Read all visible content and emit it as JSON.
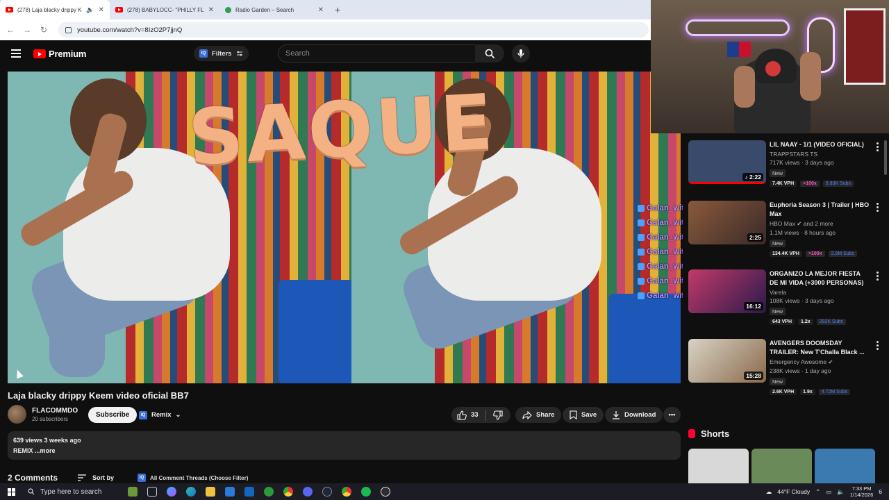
{
  "browser": {
    "tabs": [
      {
        "label": "(278) Laja blacky drippy Ke",
        "icon": "youtube-icon",
        "active": true,
        "audio": "🔈"
      },
      {
        "label": "(278) BABYLOCC- \"PHILLY FLOW",
        "icon": "youtube-icon",
        "active": false
      },
      {
        "label": "Radio Garden – Search",
        "icon": "radio-garden-icon",
        "active": false
      }
    ],
    "close_glyph": "✕",
    "new_tab_glyph": "+",
    "url": "youtube.com/watch?v=8IzO2P7jjnQ"
  },
  "youtube_header": {
    "logo_text": "Premium",
    "filters_label": "Filters",
    "filters_badge": "IQ",
    "search_placeholder": "Search"
  },
  "video": {
    "overlay_text": "SAQUE",
    "title": "Laja blacky drippy Keem video oficial BB7",
    "channel": "FLACOMMDO",
    "subscribers": "20 subscribers",
    "subscribe_label": "Subscribe",
    "remix_label": "Remix",
    "likes": "33",
    "share_label": "Share",
    "save_label": "Save",
    "download_label": "Download",
    "views_date": "639 views  3 weeks ago",
    "description": "REMIX ...more"
  },
  "chat_overlay": {
    "lines": [
      "Galan_witheclips :",
      "Galan_witheclips :",
      "Galan_witheclips :",
      "Galan_witheclips :",
      "Galan_witheclips :",
      "Galan_witheclips :",
      "Galan_witheclips :"
    ]
  },
  "recommendations": [
    {
      "title": "LIL NAAY - 1/1 (VIDEO OFICIAL)",
      "channel": "TRAPPSTARS TS",
      "meta": "717K views · 3 days ago",
      "badge": "New",
      "duration": "♪ 2:22",
      "vph": "7.4K VPH",
      "ratio": ">100x",
      "subs": "9.83K Subs",
      "thumb_color": "#3a4a6a"
    },
    {
      "title": "Euphoria Season 3 | Trailer | HBO Max",
      "channel": "HBO Max ✔ and 2 more",
      "meta": "1.1M views · 8 hours ago",
      "badge": "New",
      "duration": "2:25",
      "vph": "134.4K VPH",
      "ratio": ">100x",
      "subs": "2.9M Subs",
      "thumb_color": "#6b4a3a"
    },
    {
      "title": "ORGANIZO LA MEJOR FIESTA DE MI VIDA (+3000 PERSONAS)",
      "channel": "Varela",
      "meta": "108K views · 3 days ago",
      "badge": "New",
      "duration": "16:12",
      "vph": "643 VPH",
      "ratio": "1.2x",
      "subs": "292K Subs",
      "thumb_color": "#4a2a6a"
    },
    {
      "title": "AVENGERS DOOMSDAY TRAILER: New T'Challa Black ...",
      "channel": "Emergency Awesome ✔",
      "meta": "238K views · 1 day ago",
      "badge": "New",
      "duration": "15:28",
      "vph": "2.6K VPH",
      "ratio": "1.9x",
      "subs": "4.72M Subs",
      "thumb_color": "#7a5a3a"
    }
  ],
  "shorts": {
    "label": "Shorts"
  },
  "comments": {
    "count_label": "2 Comments",
    "sort_label": "Sort by",
    "threads_label": "All Comment Threads (Choose Filter)"
  },
  "taskbar": {
    "search_placeholder": "Type here to search",
    "weather": "44°F  Cloudy",
    "time": "7:33 PM",
    "date": "1/14/2026",
    "notifications": "6"
  }
}
